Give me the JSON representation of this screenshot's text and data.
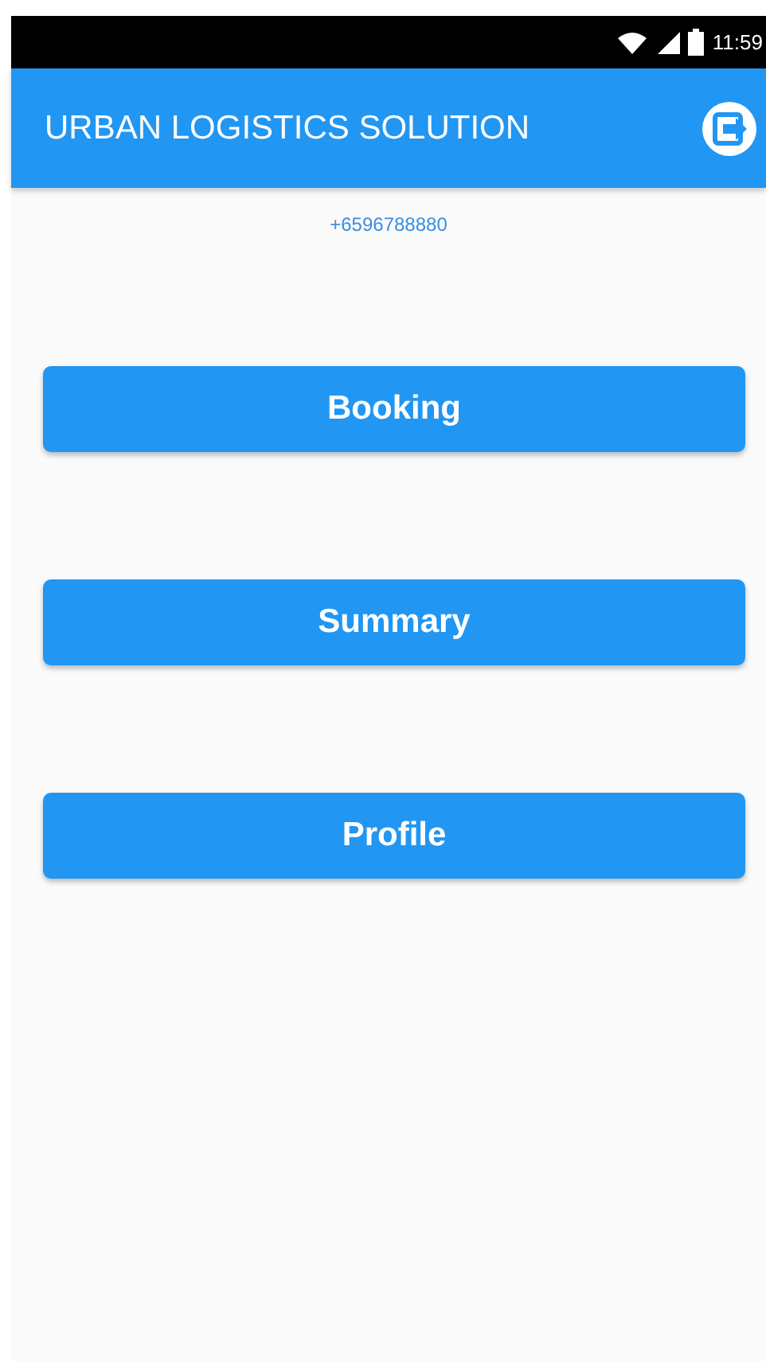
{
  "status_bar": {
    "time": "11:59"
  },
  "app_bar": {
    "title": "URBAN LOGISTICS SOLUTION"
  },
  "phone": "+6596788880",
  "buttons": [
    {
      "label": "Booking"
    },
    {
      "label": "Summary"
    },
    {
      "label": "Profile"
    }
  ]
}
